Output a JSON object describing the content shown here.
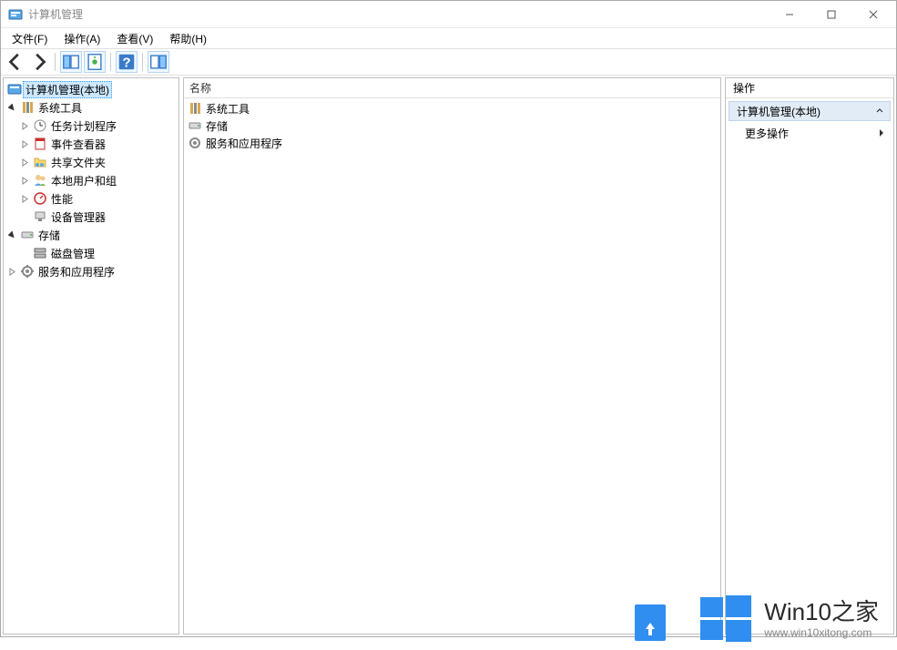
{
  "window": {
    "title": "计算机管理"
  },
  "menu": {
    "file": "文件(F)",
    "action": "操作(A)",
    "view": "查看(V)",
    "help": "帮助(H)"
  },
  "tree": {
    "root": "计算机管理(本地)",
    "system_tools": "系统工具",
    "task_scheduler": "任务计划程序",
    "event_viewer": "事件查看器",
    "shared_folders": "共享文件夹",
    "local_users": "本地用户和组",
    "performance": "性能",
    "device_manager": "设备管理器",
    "storage": "存储",
    "disk_management": "磁盘管理",
    "services_apps": "服务和应用程序"
  },
  "list": {
    "col_name": "名称",
    "items": {
      "system_tools": "系统工具",
      "storage": "存储",
      "services_apps": "服务和应用程序"
    }
  },
  "actions": {
    "header": "操作",
    "section_title": "计算机管理(本地)",
    "more_actions": "更多操作"
  },
  "watermark": {
    "brand": "Win10之家",
    "url": "www.win10xitong.com"
  }
}
